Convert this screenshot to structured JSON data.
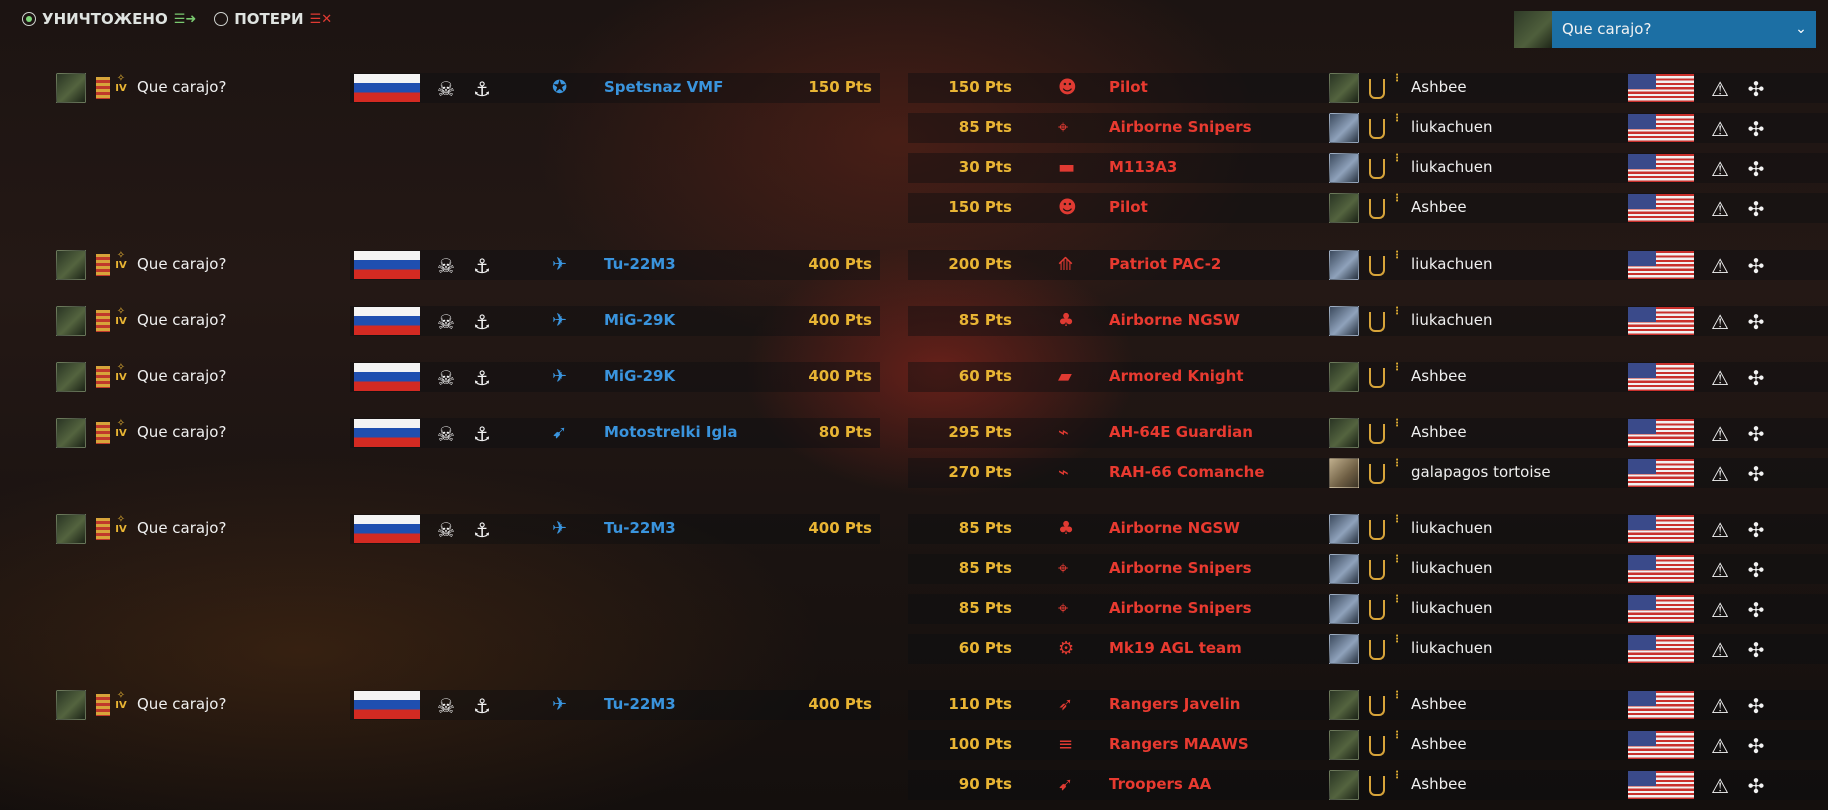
{
  "tabs": {
    "destroyed_label": "УНИЧТОЖЕНО",
    "losses_label": "ПОТЕРИ"
  },
  "player_select": {
    "value": "Que carajo?"
  },
  "colors": {
    "friendly": "#3a94dd",
    "enemy": "#e83a30",
    "points": "#e9b534",
    "dropdown": "#1c6fa4"
  },
  "rows": [
    {
      "kill": {
        "player": "Que carajo?",
        "unit": "Spetsnaz VMF",
        "unit_icon": "spetsnaz-icon",
        "pts": "150 Pts"
      },
      "loss": {
        "pts": "150 Pts",
        "unit": "Pilot",
        "unit_icon": "pilot-icon",
        "player": "Ashbee"
      }
    },
    {
      "loss": {
        "pts": "85 Pts",
        "unit": "Airborne Snipers",
        "unit_icon": "sniper-icon",
        "player": "liukachuen"
      }
    },
    {
      "loss": {
        "pts": "30 Pts",
        "unit": "M113A3",
        "unit_icon": "apc-icon",
        "player": "liukachuen"
      }
    },
    {
      "loss": {
        "pts": "150 Pts",
        "unit": "Pilot",
        "unit_icon": "pilot-icon",
        "player": "Ashbee"
      }
    },
    {
      "kill": {
        "player": "Que carajo?",
        "unit": "Tu-22M3",
        "unit_icon": "bomber-icon",
        "pts": "400 Pts"
      },
      "loss": {
        "pts": "200 Pts",
        "unit": "Patriot PAC-2",
        "unit_icon": "sam-icon",
        "player": "liukachuen"
      }
    },
    {
      "kill": {
        "player": "Que carajo?",
        "unit": "MiG-29K",
        "unit_icon": "fighter-icon",
        "pts": "400 Pts"
      },
      "loss": {
        "pts": "85 Pts",
        "unit": "Airborne NGSW",
        "unit_icon": "infantry-icon",
        "player": "liukachuen"
      }
    },
    {
      "kill": {
        "player": "Que carajo?",
        "unit": "MiG-29K",
        "unit_icon": "fighter-icon",
        "pts": "400 Pts"
      },
      "loss": {
        "pts": "60 Pts",
        "unit": "Armored Knight",
        "unit_icon": "vehicle-icon",
        "player": "Ashbee"
      }
    },
    {
      "kill": {
        "player": "Que carajo?",
        "unit": "Motostrelki Igla",
        "unit_icon": "manpads-icon",
        "pts": "80 Pts"
      },
      "loss": {
        "pts": "295 Pts",
        "unit": "AH-64E Guardian",
        "unit_icon": "helicopter-icon",
        "player": "Ashbee"
      }
    },
    {
      "loss": {
        "pts": "270 Pts",
        "unit": "RAH-66 Comanche",
        "unit_icon": "helicopter-icon",
        "player": "galapagos tortoise"
      }
    },
    {
      "kill": {
        "player": "Que carajo?",
        "unit": "Tu-22M3",
        "unit_icon": "bomber-icon",
        "pts": "400 Pts"
      },
      "loss": {
        "pts": "85 Pts",
        "unit": "Airborne NGSW",
        "unit_icon": "infantry-icon",
        "player": "liukachuen"
      }
    },
    {
      "loss": {
        "pts": "85 Pts",
        "unit": "Airborne Snipers",
        "unit_icon": "sniper-icon",
        "player": "liukachuen"
      }
    },
    {
      "loss": {
        "pts": "85 Pts",
        "unit": "Airborne Snipers",
        "unit_icon": "sniper-icon",
        "player": "liukachuen"
      }
    },
    {
      "loss": {
        "pts": "60 Pts",
        "unit": "Mk19 AGL team",
        "unit_icon": "agl-icon",
        "player": "liukachuen"
      }
    },
    {
      "kill": {
        "player": "Que carajo?",
        "unit": "Tu-22M3",
        "unit_icon": "bomber-icon",
        "pts": "400 Pts"
      },
      "loss": {
        "pts": "110 Pts",
        "unit": "Rangers Javelin",
        "unit_icon": "atgm-icon",
        "player": "Ashbee"
      }
    },
    {
      "loss": {
        "pts": "100 Pts",
        "unit": "Rangers MAAWS",
        "unit_icon": "recoilless-icon",
        "player": "Ashbee"
      }
    },
    {
      "loss": {
        "pts": "90 Pts",
        "unit": "Troopers AA",
        "unit_icon": "manpads-icon",
        "player": "Ashbee"
      }
    }
  ]
}
